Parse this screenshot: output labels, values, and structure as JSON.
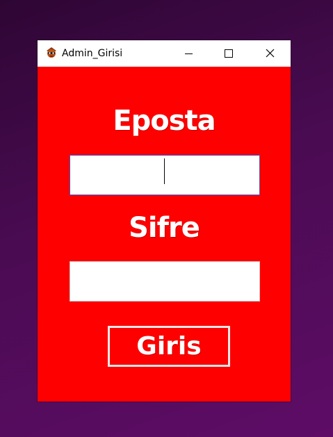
{
  "window": {
    "title": "Admin_Girisi",
    "icon": "app-logo-icon",
    "controls": {
      "minimize": "minimize-icon",
      "maximize": "maximize-icon",
      "close": "close-icon"
    }
  },
  "form": {
    "email_label": "Eposta",
    "email_value": "",
    "password_label": "Sifre",
    "password_value": "",
    "login_button": "Giris"
  },
  "colors": {
    "window_background": "#ff0000",
    "text": "#ffffff",
    "titlebar": "#ffffff",
    "desktop": "#4a0b52",
    "focused_border": "#3c5bd6"
  }
}
